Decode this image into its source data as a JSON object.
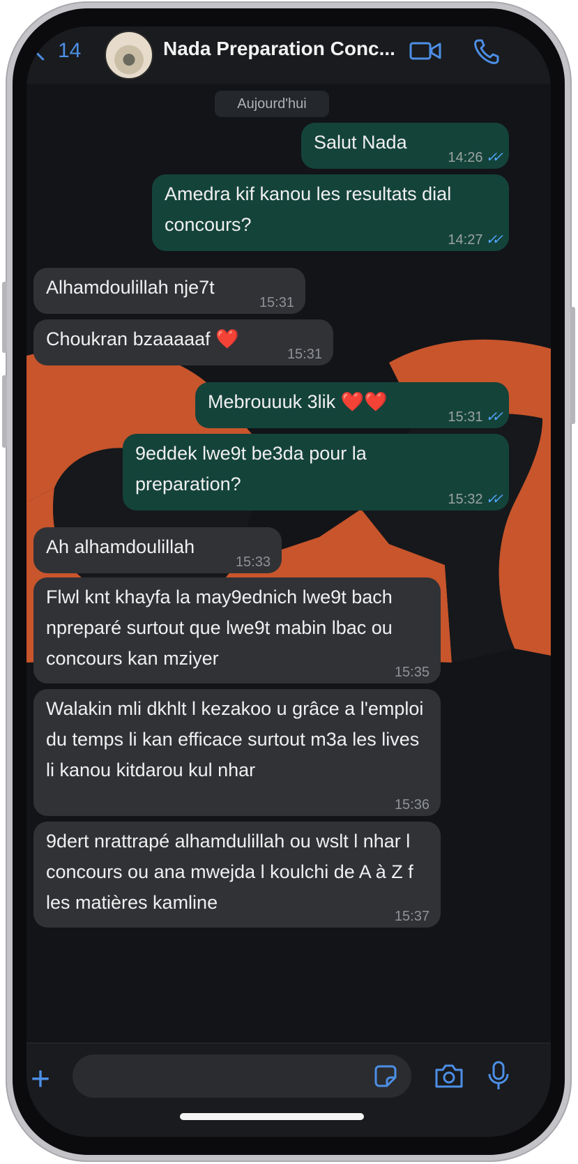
{
  "header": {
    "back_count": "14",
    "contact_name": "Nada Preparation Conc...",
    "icons": [
      "chevron-left-icon",
      "video-call-icon",
      "phone-call-icon"
    ]
  },
  "date_label": "Aujourd'hui",
  "messages": [
    {
      "dir": "out",
      "text": "Salut Nada",
      "time": "14:26",
      "read": true
    },
    {
      "dir": "out",
      "text": "Amedra kif kanou les resultats dial concours?",
      "time": "14:27",
      "read": true
    },
    {
      "dir": "in",
      "text": "Alhamdoulillah nje7t",
      "time": "15:31"
    },
    {
      "dir": "in",
      "text": "Choukran bzaaaaaf ❤️",
      "time": "15:31"
    },
    {
      "dir": "out",
      "text": "Mebrouuuk 3lik ❤️❤️",
      "time": "15:31",
      "read": true
    },
    {
      "dir": "out",
      "text": "9eddek lwe9t be3da pour la preparation?",
      "time": "15:32",
      "read": true
    },
    {
      "dir": "in",
      "text": "Ah alhamdoulillah",
      "time": "15:33"
    },
    {
      "dir": "in",
      "text": "Flwl knt khayfa la may9ednich lwe9t bach npreparé surtout que lwe9t mabin lbac ou concours kan mziyer",
      "time": "15:35"
    },
    {
      "dir": "in",
      "text": "Walakin mli dkhlt l kezakoo u grâce a l'emploi du temps li kan efficace surtout m3a les lives li kanou kitdarou kul nhar",
      "time": "15:36"
    },
    {
      "dir": "in",
      "text": "9dert nrattrapé alhamdulillah ou wslt l nhar l concours ou ana mwejda l koulchi de A à Z f les matières kamline",
      "time": "15:37"
    }
  ],
  "colors": {
    "accent": "#4d8fe6",
    "outgoing_bubble": "#14433a",
    "incoming_bubble": "#303236",
    "read_ticks": "#53a6ff"
  },
  "footer_icons": [
    "plus-icon",
    "sticker-icon",
    "camera-icon",
    "microphone-icon"
  ]
}
